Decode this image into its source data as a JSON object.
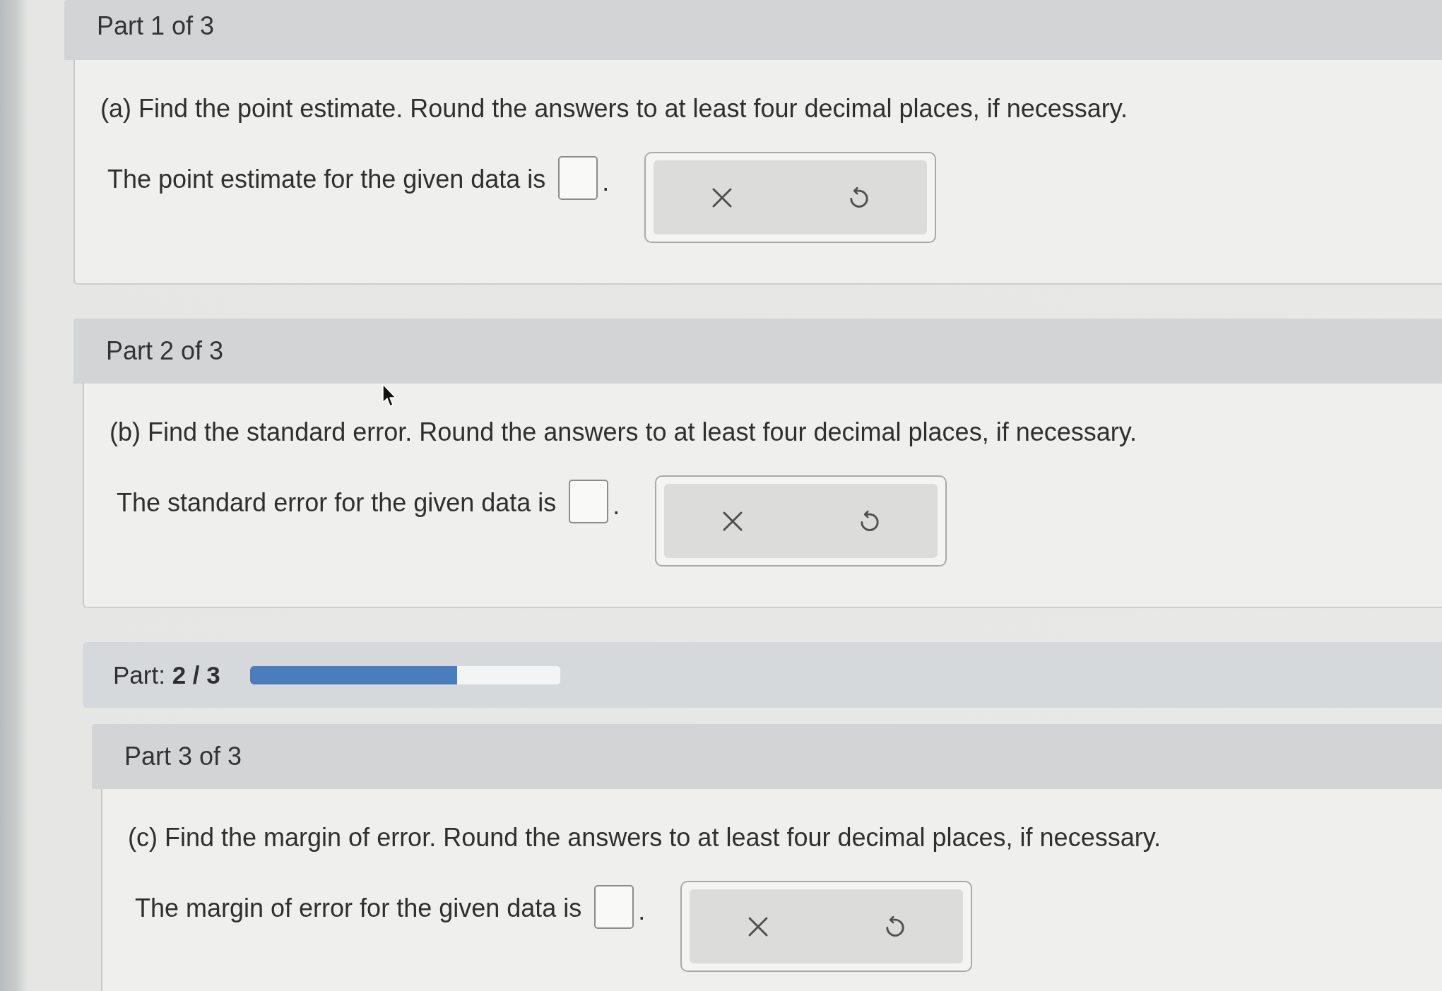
{
  "sections": [
    {
      "kind": "part",
      "header": "Part 1 of 3",
      "question": "(a) Find the point estimate. Round the answers to at least four decimal places, if necessary.",
      "prompt": "The point estimate for the given data is",
      "suffix": "."
    },
    {
      "kind": "part",
      "header": "Part 2 of 3",
      "question": "(b) Find the standard error. Round the answers to at least four decimal places, if necessary.",
      "prompt": "The standard error for the given data is",
      "suffix": "."
    },
    {
      "kind": "progress",
      "label": "Part: **2 / 3**",
      "level": 0.667
    },
    {
      "kind": "part",
      "header": "Part 3 of 3",
      "question": "(c) Find the margin of error. Round the answers to at least four decimal places, if necessary.",
      "prompt": "The margin of error for the given data is",
      "suffix": "."
    }
  ]
}
